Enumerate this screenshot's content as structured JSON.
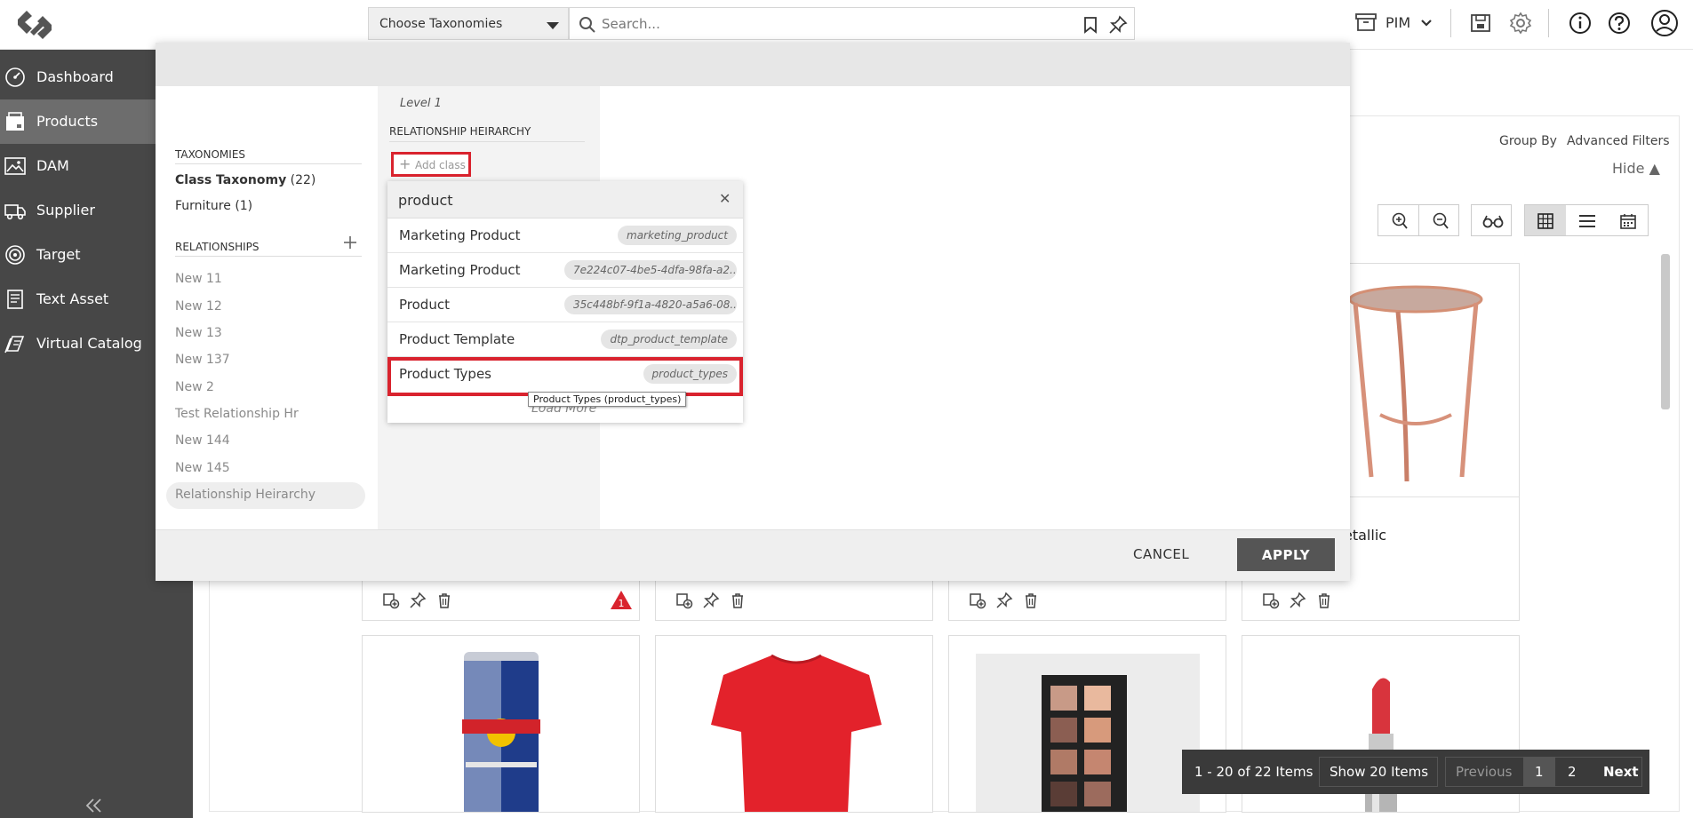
{
  "topbar": {
    "taxonomy_select": "Choose Taxonomies",
    "search_placeholder": "Search...",
    "app_switcher": "PIM"
  },
  "sidebar": {
    "items": [
      {
        "label": "Dashboard",
        "icon": "dashboard-icon"
      },
      {
        "label": "Products",
        "icon": "products-icon",
        "active": true
      },
      {
        "label": "DAM",
        "icon": "image-icon"
      },
      {
        "label": "Supplier",
        "icon": "truck-icon"
      },
      {
        "label": "Target",
        "icon": "target-icon"
      },
      {
        "label": "Text Asset",
        "icon": "document-icon"
      },
      {
        "label": "Virtual Catalog",
        "icon": "catalog-icon"
      }
    ]
  },
  "content": {
    "group_by": "Group By",
    "advanced_filters": "Advanced Filters",
    "hide": "Hide ▲",
    "card_title_partial": "etallic",
    "alert_count": "1",
    "pagination": {
      "range": "1 - 20 of 22 Items",
      "show": "Show 20 Items",
      "previous": "Previous",
      "page1": "1",
      "page2": "2",
      "next": "Next"
    }
  },
  "modal": {
    "taxonomies_title": "TAXONOMIES",
    "taxonomies": [
      {
        "name": "Class Taxonomy",
        "count": "(22)"
      },
      {
        "name": "Furniture",
        "count": "(1)"
      }
    ],
    "relationships_title": "RELATIONSHIPS",
    "relationships": [
      "New 11",
      "New 12",
      "New 13",
      "New 137",
      "New 2",
      "Test Relationship Hr",
      "New 144",
      "New 145",
      "Relationship Heirarchy"
    ],
    "level_label": "Level 1",
    "hierarchy_title": "RELATIONSHIP HEIRARCHY",
    "add_class": "Add class",
    "dropdown": {
      "query": "product",
      "options": [
        {
          "name": "Marketing Product",
          "code": "marketing_product"
        },
        {
          "name": "Marketing Product",
          "code": "7e224c07-4be5-4dfa-98fa-a2..."
        },
        {
          "name": "Product",
          "code": "35c448bf-9f1a-4820-a5a6-08..."
        },
        {
          "name": "Product Template",
          "code": "dtp_product_template"
        },
        {
          "name": "Product Types",
          "code": "product_types"
        }
      ],
      "load_more": "Load More",
      "tooltip": "Product Types (product_types)"
    },
    "cancel": "CANCEL",
    "apply": "APPLY"
  },
  "colors": {
    "sidebar_bg": "#474747",
    "sidebar_active": "#6d6d6d",
    "highlight": "#d9232e",
    "apply_bg": "#555555"
  }
}
